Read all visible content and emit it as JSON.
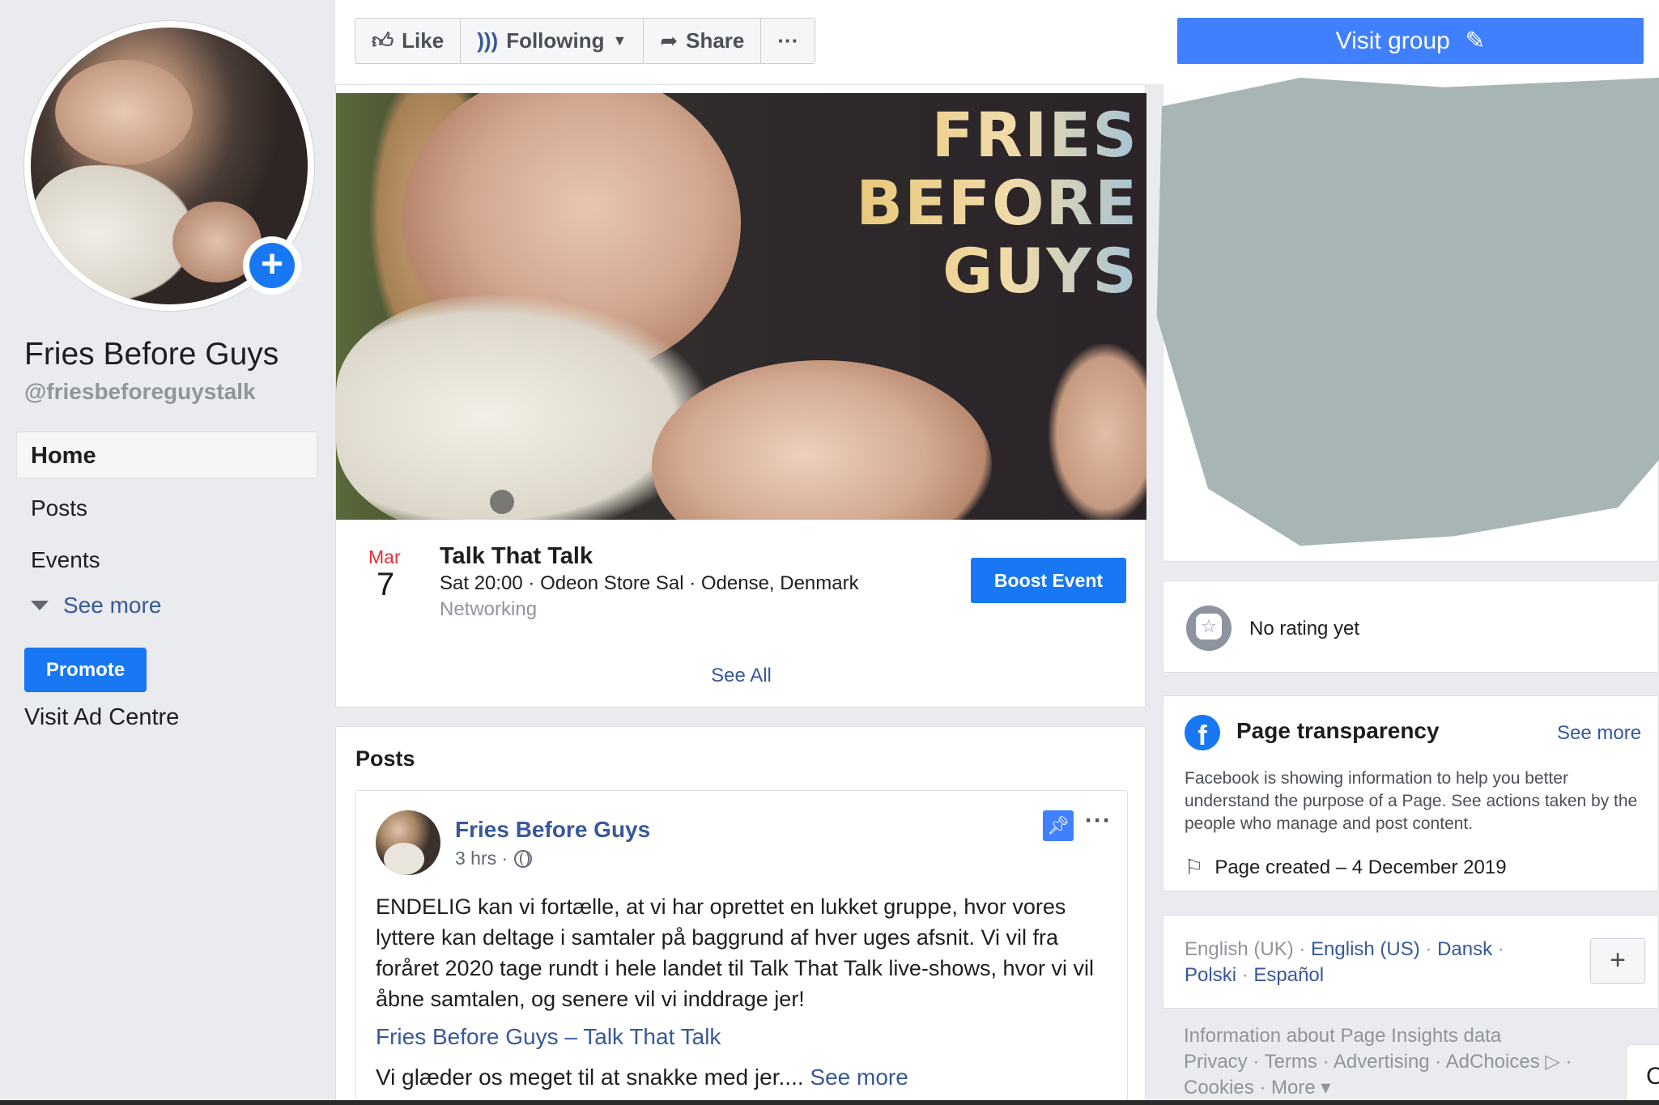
{
  "page": {
    "name": "Fries Before Guys",
    "handle": "@friesbeforeguystalk"
  },
  "nav": {
    "home": "Home",
    "posts": "Posts",
    "events": "Events",
    "see_more": "See more",
    "promote": "Promote",
    "visit_ad_centre": "Visit Ad Centre"
  },
  "actions": {
    "like": "Like",
    "following": "Following",
    "share": "Share",
    "more": "···",
    "visit_group": "Visit group"
  },
  "cover": {
    "title_lines": [
      "FRIES",
      "BEFORE",
      "GUYS"
    ]
  },
  "event": {
    "month": "Mar",
    "day": "7",
    "title": "Talk That Talk",
    "detail": "Sat 20:00 · Odeon Store Sal · Odense, Denmark",
    "category": "Networking",
    "boost": "Boost Event",
    "see_all": "See All"
  },
  "posts": {
    "heading": "Posts",
    "author": "Fries Before Guys",
    "time": "3 hrs ·",
    "more": "···",
    "body": "ENDELIG kan vi fortælle, at vi har oprettet en lukket gruppe, hvor vores lyttere kan deltage i samtaler på baggrund af hver uges afsnit. Vi vil fra foråret 2020 tage rundt i hele landet til Talk That Talk live-shows, hvor vi vil åbne samtalen, og senere vil vi inddrage jer!",
    "link": "Fries Before Guys – Talk That Talk",
    "body2": "Vi glæder os meget til at snakke med jer....",
    "see_more": "See more"
  },
  "rating": {
    "text": "No rating yet"
  },
  "transparency": {
    "title": "Page transparency",
    "see_more": "See more",
    "description": "Facebook is showing information to help you better understand the purpose of a Page. See actions taken by the people who manage and post content.",
    "created": "Page created – 4 December 2019"
  },
  "languages": {
    "current": "English (UK)",
    "others": [
      "English (US)",
      "Dansk",
      "Polski",
      "Español"
    ],
    "add": "+"
  },
  "footer": {
    "line1": "Information about Page Insights data",
    "line2": "Privacy · Terms · Advertising · AdChoices ▷ ·",
    "line3": "Cookies · More ▾"
  },
  "chat": {
    "label": "C"
  },
  "colors": {
    "fb_blue": "#1877f2",
    "link_blue": "#385898",
    "visit_group_blue": "#4080ff",
    "event_month_red": "#e32f3c",
    "background": "#e9ebee",
    "redaction": "#a8b8b6"
  }
}
